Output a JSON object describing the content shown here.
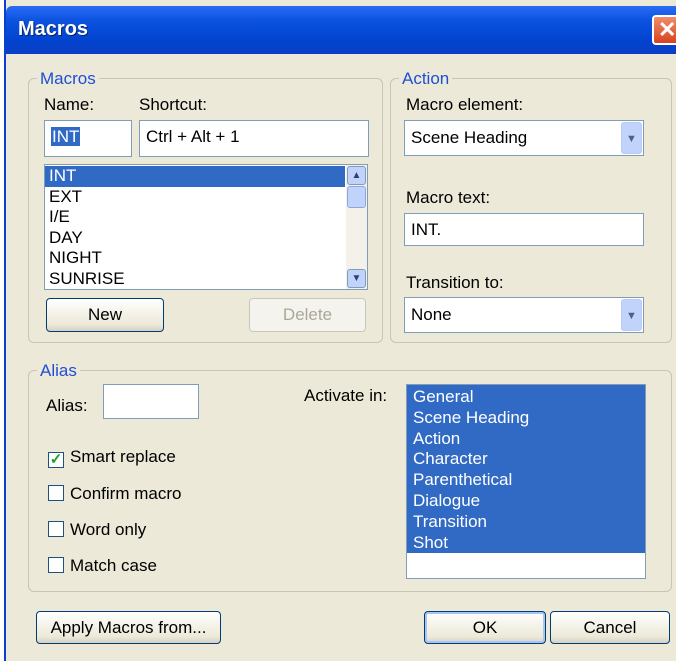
{
  "window": {
    "title": "Macros",
    "close_glyph": "✕"
  },
  "macros_group": {
    "legend": "Macros",
    "name_label": "Name:",
    "name_value": "INT",
    "shortcut_label": "Shortcut:",
    "shortcut_value": "Ctrl + Alt + 1",
    "list": [
      "INT",
      "EXT",
      "I/E",
      "DAY",
      "NIGHT",
      "SUNRISE"
    ],
    "selected_index": 0,
    "new_label": "New",
    "delete_label": "Delete"
  },
  "action_group": {
    "legend": "Action",
    "macro_element_label": "Macro element:",
    "macro_element_value": "Scene Heading",
    "macro_text_label": "Macro text:",
    "macro_text_value": "INT.",
    "transition_label": "Transition to:",
    "transition_value": "None"
  },
  "alias_group": {
    "legend": "Alias",
    "alias_label": "Alias:",
    "alias_value": "",
    "activate_label": "Activate in:",
    "activate_items": [
      "General",
      "Scene Heading",
      "Action",
      "Character",
      "Parenthetical",
      "Dialogue",
      "Transition",
      "Shot"
    ],
    "options": [
      {
        "label": "Smart replace",
        "checked": true
      },
      {
        "label": "Confirm macro",
        "checked": false
      },
      {
        "label": "Word only",
        "checked": false
      },
      {
        "label": "Match case",
        "checked": false
      }
    ]
  },
  "footer": {
    "apply_label": "Apply Macros from...",
    "ok_label": "OK",
    "cancel_label": "Cancel"
  },
  "icons": {
    "scroll_up": "▲",
    "scroll_down": "▼",
    "dropdown": "▼",
    "check": "✓"
  }
}
